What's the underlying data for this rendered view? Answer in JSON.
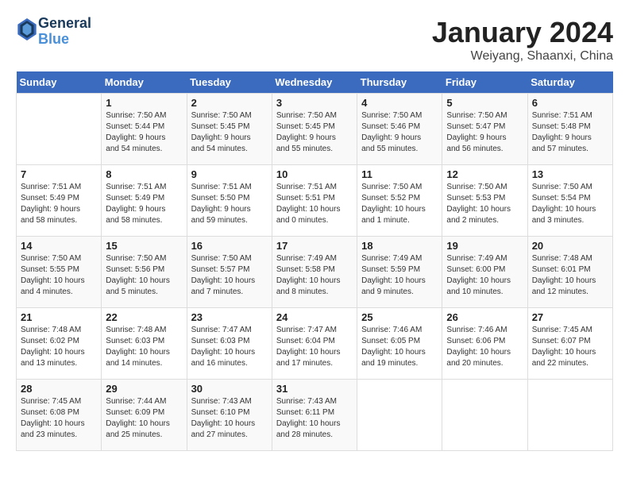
{
  "logo": {
    "line1": "General",
    "line2": "Blue"
  },
  "title": "January 2024",
  "location": "Weiyang, Shaanxi, China",
  "header": {
    "days": [
      "Sunday",
      "Monday",
      "Tuesday",
      "Wednesday",
      "Thursday",
      "Friday",
      "Saturday"
    ]
  },
  "weeks": [
    [
      {
        "day": "",
        "info": ""
      },
      {
        "day": "1",
        "info": "Sunrise: 7:50 AM\nSunset: 5:44 PM\nDaylight: 9 hours\nand 54 minutes."
      },
      {
        "day": "2",
        "info": "Sunrise: 7:50 AM\nSunset: 5:45 PM\nDaylight: 9 hours\nand 54 minutes."
      },
      {
        "day": "3",
        "info": "Sunrise: 7:50 AM\nSunset: 5:45 PM\nDaylight: 9 hours\nand 55 minutes."
      },
      {
        "day": "4",
        "info": "Sunrise: 7:50 AM\nSunset: 5:46 PM\nDaylight: 9 hours\nand 55 minutes."
      },
      {
        "day": "5",
        "info": "Sunrise: 7:50 AM\nSunset: 5:47 PM\nDaylight: 9 hours\nand 56 minutes."
      },
      {
        "day": "6",
        "info": "Sunrise: 7:51 AM\nSunset: 5:48 PM\nDaylight: 9 hours\nand 57 minutes."
      }
    ],
    [
      {
        "day": "7",
        "info": "Sunrise: 7:51 AM\nSunset: 5:49 PM\nDaylight: 9 hours\nand 58 minutes."
      },
      {
        "day": "8",
        "info": "Sunrise: 7:51 AM\nSunset: 5:49 PM\nDaylight: 9 hours\nand 58 minutes."
      },
      {
        "day": "9",
        "info": "Sunrise: 7:51 AM\nSunset: 5:50 PM\nDaylight: 9 hours\nand 59 minutes."
      },
      {
        "day": "10",
        "info": "Sunrise: 7:51 AM\nSunset: 5:51 PM\nDaylight: 10 hours\nand 0 minutes."
      },
      {
        "day": "11",
        "info": "Sunrise: 7:50 AM\nSunset: 5:52 PM\nDaylight: 10 hours\nand 1 minute."
      },
      {
        "day": "12",
        "info": "Sunrise: 7:50 AM\nSunset: 5:53 PM\nDaylight: 10 hours\nand 2 minutes."
      },
      {
        "day": "13",
        "info": "Sunrise: 7:50 AM\nSunset: 5:54 PM\nDaylight: 10 hours\nand 3 minutes."
      }
    ],
    [
      {
        "day": "14",
        "info": "Sunrise: 7:50 AM\nSunset: 5:55 PM\nDaylight: 10 hours\nand 4 minutes."
      },
      {
        "day": "15",
        "info": "Sunrise: 7:50 AM\nSunset: 5:56 PM\nDaylight: 10 hours\nand 5 minutes."
      },
      {
        "day": "16",
        "info": "Sunrise: 7:50 AM\nSunset: 5:57 PM\nDaylight: 10 hours\nand 7 minutes."
      },
      {
        "day": "17",
        "info": "Sunrise: 7:49 AM\nSunset: 5:58 PM\nDaylight: 10 hours\nand 8 minutes."
      },
      {
        "day": "18",
        "info": "Sunrise: 7:49 AM\nSunset: 5:59 PM\nDaylight: 10 hours\nand 9 minutes."
      },
      {
        "day": "19",
        "info": "Sunrise: 7:49 AM\nSunset: 6:00 PM\nDaylight: 10 hours\nand 10 minutes."
      },
      {
        "day": "20",
        "info": "Sunrise: 7:48 AM\nSunset: 6:01 PM\nDaylight: 10 hours\nand 12 minutes."
      }
    ],
    [
      {
        "day": "21",
        "info": "Sunrise: 7:48 AM\nSunset: 6:02 PM\nDaylight: 10 hours\nand 13 minutes."
      },
      {
        "day": "22",
        "info": "Sunrise: 7:48 AM\nSunset: 6:03 PM\nDaylight: 10 hours\nand 14 minutes."
      },
      {
        "day": "23",
        "info": "Sunrise: 7:47 AM\nSunset: 6:03 PM\nDaylight: 10 hours\nand 16 minutes."
      },
      {
        "day": "24",
        "info": "Sunrise: 7:47 AM\nSunset: 6:04 PM\nDaylight: 10 hours\nand 17 minutes."
      },
      {
        "day": "25",
        "info": "Sunrise: 7:46 AM\nSunset: 6:05 PM\nDaylight: 10 hours\nand 19 minutes."
      },
      {
        "day": "26",
        "info": "Sunrise: 7:46 AM\nSunset: 6:06 PM\nDaylight: 10 hours\nand 20 minutes."
      },
      {
        "day": "27",
        "info": "Sunrise: 7:45 AM\nSunset: 6:07 PM\nDaylight: 10 hours\nand 22 minutes."
      }
    ],
    [
      {
        "day": "28",
        "info": "Sunrise: 7:45 AM\nSunset: 6:08 PM\nDaylight: 10 hours\nand 23 minutes."
      },
      {
        "day": "29",
        "info": "Sunrise: 7:44 AM\nSunset: 6:09 PM\nDaylight: 10 hours\nand 25 minutes."
      },
      {
        "day": "30",
        "info": "Sunrise: 7:43 AM\nSunset: 6:10 PM\nDaylight: 10 hours\nand 27 minutes."
      },
      {
        "day": "31",
        "info": "Sunrise: 7:43 AM\nSunset: 6:11 PM\nDaylight: 10 hours\nand 28 minutes."
      },
      {
        "day": "",
        "info": ""
      },
      {
        "day": "",
        "info": ""
      },
      {
        "day": "",
        "info": ""
      }
    ]
  ]
}
